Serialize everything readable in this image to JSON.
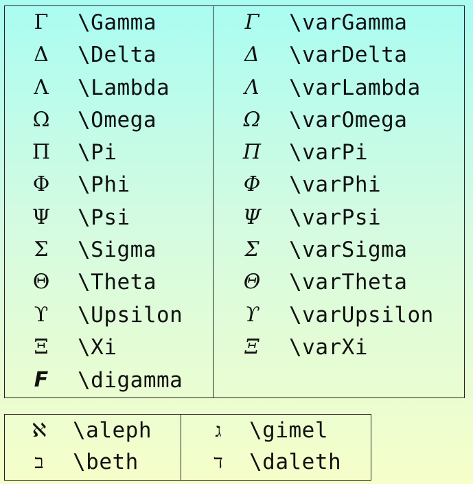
{
  "greek_upright": [
    {
      "glyph": "Γ",
      "command": "\\Gamma"
    },
    {
      "glyph": "Δ",
      "command": "\\Delta"
    },
    {
      "glyph": "Λ",
      "command": "\\Lambda"
    },
    {
      "glyph": "Ω",
      "command": "\\Omega"
    },
    {
      "glyph": "Π",
      "command": "\\Pi"
    },
    {
      "glyph": "Φ",
      "command": "\\Phi"
    },
    {
      "glyph": "Ψ",
      "command": "\\Psi"
    },
    {
      "glyph": "Σ",
      "command": "\\Sigma"
    },
    {
      "glyph": "Θ",
      "command": "\\Theta"
    },
    {
      "glyph": "ϒ",
      "command": "\\Upsilon"
    },
    {
      "glyph": "Ξ",
      "command": "\\Xi"
    },
    {
      "glyph": "Ϝ",
      "command": "\\digamma"
    }
  ],
  "greek_italic": [
    {
      "glyph": "Γ",
      "command": "\\varGamma"
    },
    {
      "glyph": "Δ",
      "command": "\\varDelta"
    },
    {
      "glyph": "Λ",
      "command": "\\varLambda"
    },
    {
      "glyph": "Ω",
      "command": "\\varOmega"
    },
    {
      "glyph": "Π",
      "command": "\\varPi"
    },
    {
      "glyph": "Φ",
      "command": "\\varPhi"
    },
    {
      "glyph": "Ψ",
      "command": "\\varPsi"
    },
    {
      "glyph": "Σ",
      "command": "\\varSigma"
    },
    {
      "glyph": "Θ",
      "command": "\\varTheta"
    },
    {
      "glyph": "ϒ",
      "command": "\\varUpsilon"
    },
    {
      "glyph": "Ξ",
      "command": "\\varXi"
    }
  ],
  "hebrew_left": [
    {
      "glyph": "ℵ",
      "command": "\\aleph"
    },
    {
      "glyph": "ב",
      "command": "\\beth"
    }
  ],
  "hebrew_right": [
    {
      "glyph": "ג",
      "command": "\\gimel"
    },
    {
      "glyph": "ד",
      "command": "\\daleth"
    }
  ]
}
